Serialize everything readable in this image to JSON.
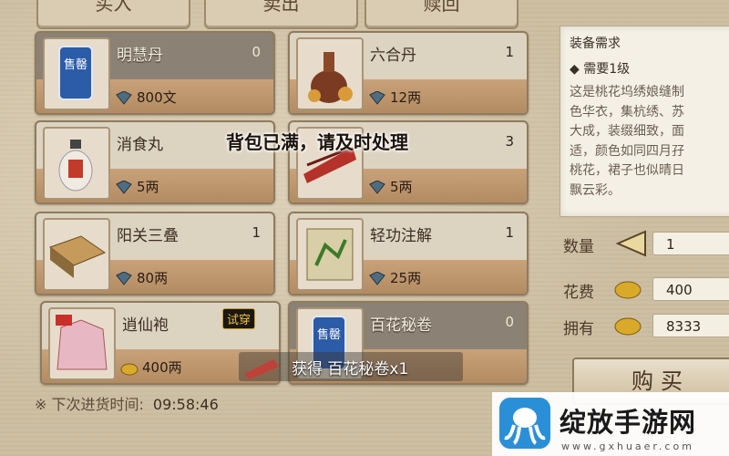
{
  "tabs": [
    {
      "label": "买入"
    },
    {
      "label": "卖出"
    },
    {
      "label": "赎回"
    }
  ],
  "items": [
    {
      "name": "明慧丹",
      "count": "0",
      "price": "800文",
      "state": "dark",
      "icon": "sold-out-seal-icon"
    },
    {
      "name": "六合丹",
      "count": "1",
      "price": "12两",
      "state": "light",
      "icon": "medicine-gourd-icon"
    },
    {
      "name": "消食丸",
      "count": "",
      "price": "5两",
      "state": "light",
      "icon": "pill-bottle-icon"
    },
    {
      "name": "",
      "count": "3",
      "price": "5两",
      "state": "light",
      "icon": "fan-scroll-icon"
    },
    {
      "name": "阳关三叠",
      "count": "1",
      "price": "80两",
      "state": "light",
      "icon": "music-book-icon"
    },
    {
      "name": "轻功注解",
      "count": "1",
      "price": "25两",
      "state": "light",
      "icon": "martial-scroll-icon"
    },
    {
      "name": "逍仙袍",
      "count": "",
      "price": "400两",
      "state": "light",
      "icon": "robe-icon",
      "tag": "试穿"
    },
    {
      "name": "百花秘卷",
      "count": "0",
      "price": "",
      "state": "dark",
      "icon": "sold-out-seal-icon"
    }
  ],
  "sold_out_seal": "售罄",
  "panel": {
    "heading": "装备需求",
    "requirement": "◆ 需要1级",
    "description": "这是桃花坞绣娘缝制\n色华衣，集杭绣、苏\n大成，装缀细致，面\n适，颜色如同四月孖\n桃花，裙子也似晴日\n飘云彩。"
  },
  "quantity": {
    "label": "数量",
    "value": "1"
  },
  "cost": {
    "label": "花费",
    "value": "400"
  },
  "own": {
    "label": "拥有",
    "value": "8333"
  },
  "buy_label": "购买",
  "notice": "背包已满，请及时处理",
  "gain_message": "获得 百花秘卷x1",
  "timer": {
    "label": "※ 下次进货时间:",
    "value": "09:58:46"
  },
  "watermark": {
    "name": "绽放手游网",
    "url": "www.gxhuaer.com"
  },
  "colors": {
    "card_strip": "#b38b63",
    "gold": "#d9a92a"
  }
}
